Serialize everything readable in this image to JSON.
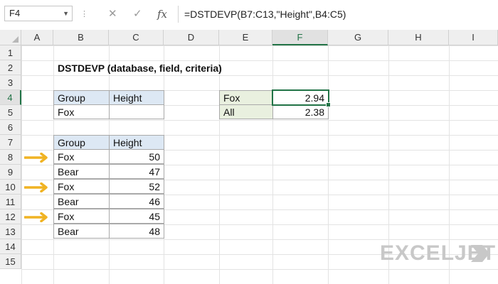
{
  "formula_bar": {
    "name_box": "F4",
    "cancel_icon": "✕",
    "enter_icon": "✓",
    "fx_label": "fx",
    "formula": "=DSTDEVP(B7:C13,\"Height\",B4:C5)"
  },
  "columns": [
    "A",
    "B",
    "C",
    "D",
    "E",
    "F",
    "G",
    "H",
    "I"
  ],
  "rows": [
    "1",
    "2",
    "3",
    "4",
    "5",
    "6",
    "7",
    "8",
    "9",
    "10",
    "11",
    "12",
    "13",
    "14",
    "15"
  ],
  "sheet": {
    "title": "DSTDEVP (database, field, criteria)",
    "criteria": {
      "headers": [
        "Group",
        "Height"
      ],
      "row": [
        "Fox",
        ""
      ]
    },
    "database": {
      "headers": [
        "Group",
        "Height"
      ],
      "rows": [
        [
          "Fox",
          "50"
        ],
        [
          "Bear",
          "47"
        ],
        [
          "Fox",
          "52"
        ],
        [
          "Bear",
          "46"
        ],
        [
          "Fox",
          "45"
        ],
        [
          "Bear",
          "48"
        ]
      ]
    },
    "results": [
      {
        "label": "Fox",
        "value": "2.94"
      },
      {
        "label": "All",
        "value": "2.38"
      }
    ]
  },
  "colors": {
    "accent": "#217346",
    "header_fill": "#dde8f4",
    "label_fill": "#e9f0df",
    "arrow": "#f0b323"
  },
  "logo": {
    "text": "EXCELJET"
  }
}
